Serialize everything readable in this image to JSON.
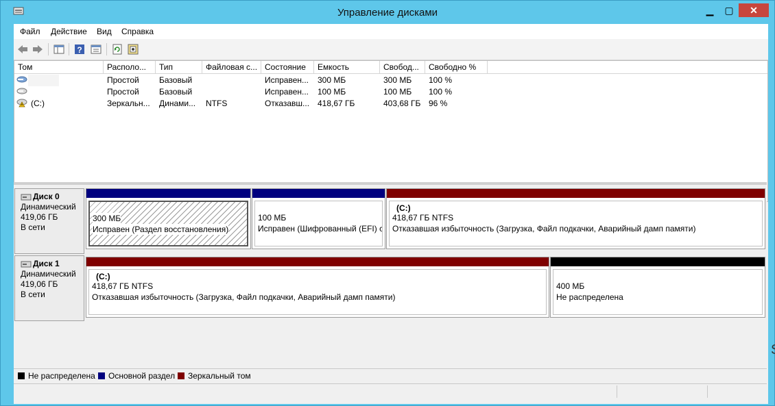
{
  "window": {
    "title": "Управление дисками"
  },
  "menu": [
    "Файл",
    "Действие",
    "Вид",
    "Справка"
  ],
  "table": {
    "columns": [
      "Том",
      "Располо...",
      "Тип",
      "Файловая с...",
      "Состояние",
      "Емкость",
      "Свобод...",
      "Свободно %"
    ],
    "rows": [
      {
        "volume": "",
        "layout": "Простой",
        "type": "Базовый",
        "fs": "",
        "status": "Исправен...",
        "capacity": "300 МБ",
        "free": "300 МБ",
        "free_pct": "100 %"
      },
      {
        "volume": "",
        "layout": "Простой",
        "type": "Базовый",
        "fs": "",
        "status": "Исправен...",
        "capacity": "100 МБ",
        "free": "100 МБ",
        "free_pct": "100 %"
      },
      {
        "volume": "(C:)",
        "layout": "Зеркальн...",
        "type": "Динами...",
        "fs": "NTFS",
        "status": "Отказавш...",
        "capacity": "418,67 ГБ",
        "free": "403,68 ГБ",
        "free_pct": "96 %"
      }
    ]
  },
  "disks": [
    {
      "name": "Диск 0",
      "kind": "Динамический",
      "size": "419,06 ГБ",
      "state": "В сети",
      "partitions": [
        {
          "label": "",
          "size": "300 МБ",
          "status": "Исправен (Раздел восстановления)",
          "color": "#00007f"
        },
        {
          "label": "",
          "size": "100 МБ",
          "status": "Исправен (Шифрованный (EFI) с",
          "color": "#00007f"
        },
        {
          "label": "(C:)",
          "size": "418,67 ГБ NTFS",
          "status": "Отказавшая избыточность (Загрузка, Файл подкачки, Аварийный дамп памяти)",
          "color": "#7f0000"
        }
      ]
    },
    {
      "name": "Диск 1",
      "kind": "Динамический",
      "size": "419,06 ГБ",
      "state": "В сети",
      "partitions": [
        {
          "label": "(C:)",
          "size": "418,67 ГБ NTFS",
          "status": "Отказавшая избыточность (Загрузка, Файл подкачки, Аварийный дамп памяти)",
          "color": "#7f0000"
        },
        {
          "label": "",
          "size": "400 МБ",
          "status": "Не распределена",
          "color": "#000000"
        }
      ]
    }
  ],
  "legend": [
    {
      "label": "Не распределена",
      "color": "#000000"
    },
    {
      "label": "Основной раздел",
      "color": "#00007f"
    },
    {
      "label": "Зеркальный том",
      "color": "#7f0000"
    }
  ],
  "icons": [
    "app-disk-icon",
    "minimize-icon",
    "maximize-icon",
    "close-icon",
    "back-arrow-icon",
    "forward-arrow-icon",
    "console-tree-icon",
    "help-icon",
    "properties-icon",
    "refresh-icon",
    "rescan-icon",
    "disk-icon",
    "warning-disk-icon"
  ],
  "side_glyph": "S"
}
